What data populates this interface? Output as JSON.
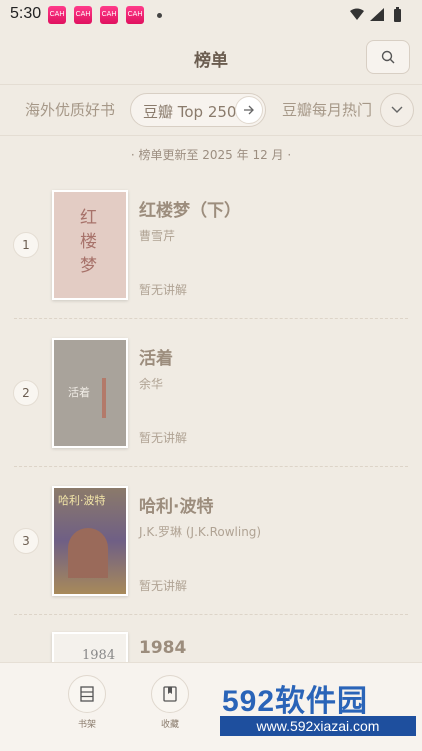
{
  "status_bar": {
    "time": "5:30",
    "notifications": [
      "CAH",
      "CAH",
      "CAH",
      "CAH"
    ]
  },
  "header": {
    "title": "榜单"
  },
  "tabs": {
    "items": [
      {
        "label": "海外优质好书"
      },
      {
        "label": "豆瓣 Top 250"
      },
      {
        "label": "豆瓣每月热门"
      }
    ],
    "active_index": 1
  },
  "update_note": "· 榜单更新至 2025 年 12 月 ·",
  "books": [
    {
      "rank": "1",
      "title": "红楼梦（下）",
      "author": "曹雪芹",
      "note": "暂无讲解",
      "cover_text": "红楼梦",
      "cover_color": "#e3ccc4"
    },
    {
      "rank": "2",
      "title": "活着",
      "author": "余华",
      "note": "暂无讲解",
      "cover_text": "活着",
      "cover_color": "#a9a39b"
    },
    {
      "rank": "3",
      "title": "哈利·波特",
      "author": "J.K.罗琳 (J.K.Rowling)",
      "note": "暂无讲解",
      "cover_text": "哈利·波特",
      "cover_color": "#7a6a8a"
    },
    {
      "rank": "4",
      "title": "1984",
      "author": "",
      "note": "",
      "cover_text": "1984",
      "cover_color": "#f4f1ec"
    }
  ],
  "bottom_nav": [
    {
      "label": "书架",
      "icon": "bookshelf-icon"
    },
    {
      "label": "收藏",
      "icon": "bookmark-icon"
    }
  ],
  "watermark": {
    "brand": "592软件园",
    "url": "www.592xiazai.com"
  },
  "colors": {
    "background": "#f0ebe3",
    "accent": "#7d6f62"
  }
}
